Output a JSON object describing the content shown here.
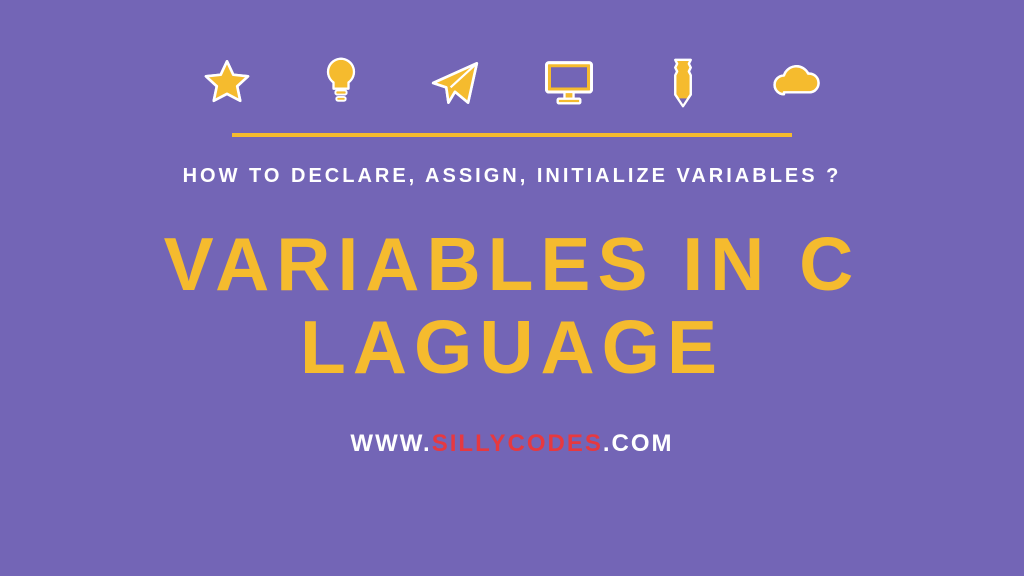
{
  "colors": {
    "background": "#7365b6",
    "accent": "#f5bb2e",
    "white": "#ffffff",
    "red": "#e63940"
  },
  "icons": [
    "star",
    "lightbulb",
    "paper-plane",
    "monitor",
    "pencil",
    "cloud"
  ],
  "subtitle": "HOW TO DECLARE, ASSIGN, INITIALIZE VARIABLES ?",
  "title": "VARIABLES IN C  LAGUAGE",
  "website": {
    "prefix": "WWW.",
    "main": "SILLYCODES",
    "suffix": ".COM"
  }
}
